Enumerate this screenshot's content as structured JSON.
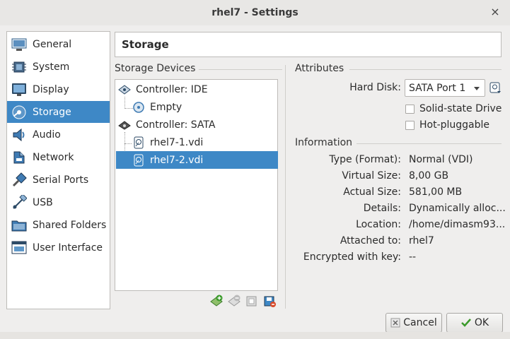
{
  "window": {
    "title": "rhel7 - Settings",
    "close_glyph": "×"
  },
  "sidebar": {
    "items": [
      {
        "label": "General",
        "icon": "general-icon"
      },
      {
        "label": "System",
        "icon": "system-icon"
      },
      {
        "label": "Display",
        "icon": "display-icon"
      },
      {
        "label": "Storage",
        "icon": "storage-icon",
        "active": true
      },
      {
        "label": "Audio",
        "icon": "audio-icon"
      },
      {
        "label": "Network",
        "icon": "network-icon"
      },
      {
        "label": "Serial Ports",
        "icon": "serial-ports-icon"
      },
      {
        "label": "USB",
        "icon": "usb-icon"
      },
      {
        "label": "Shared Folders",
        "icon": "shared-folders-icon"
      },
      {
        "label": "User Interface",
        "icon": "user-interface-icon"
      }
    ]
  },
  "header": {
    "title": "Storage"
  },
  "storage_devices": {
    "title": "Storage Devices",
    "tree": [
      {
        "label": "Controller: IDE",
        "type": "controller"
      },
      {
        "label": "Empty",
        "type": "optical"
      },
      {
        "label": "Controller: SATA",
        "type": "controller"
      },
      {
        "label": "rhel7-1.vdi",
        "type": "disk"
      },
      {
        "label": "rhel7-2.vdi",
        "type": "disk",
        "selected": true
      }
    ]
  },
  "attributes": {
    "title": "Attributes",
    "hard_disk_label": "Hard Disk:",
    "hard_disk_value": "SATA Port 1",
    "solid_state_label": "Solid-state Drive",
    "hot_pluggable_label": "Hot-pluggable"
  },
  "information": {
    "title": "Information",
    "rows": [
      {
        "key": "Type (Format):",
        "value": "Normal (VDI)"
      },
      {
        "key": "Virtual Size:",
        "value": "8,00 GB"
      },
      {
        "key": "Actual Size:",
        "value": "581,00 MB"
      },
      {
        "key": "Details:",
        "value": "Dynamically alloc..."
      },
      {
        "key": "Location:",
        "value": "/home/dimasm93..."
      },
      {
        "key": "Attached to:",
        "value": "rhel7"
      },
      {
        "key": "Encrypted with key:",
        "value": "--"
      }
    ]
  },
  "buttons": {
    "cancel": "Cancel",
    "ok": "OK"
  },
  "colors": {
    "selection": "#3e88c6",
    "accent_green": "#3a9a2a"
  }
}
